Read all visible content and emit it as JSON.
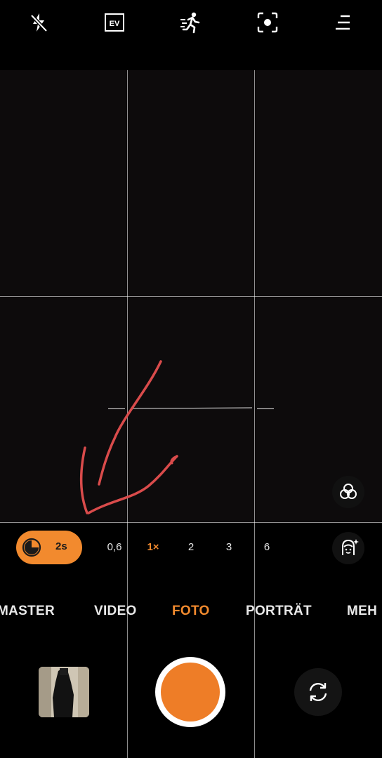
{
  "top_icons": [
    "flash-off-icon",
    "ev-icon",
    "motion-icon",
    "focus-icon",
    "menu-icon"
  ],
  "ev_label": "EV",
  "timer": {
    "label": "2s"
  },
  "zoom_levels": [
    "0,6",
    "1×",
    "2",
    "3",
    "6"
  ],
  "zoom_active": "1×",
  "modes": [
    "MASTER",
    "VIDEO",
    "FOTO",
    "PORTRÄT",
    "MEH"
  ],
  "mode_active": "FOTO",
  "colors": {
    "accent": "#f28a2e",
    "annotation": "#d94b4b",
    "background": "#000000"
  }
}
